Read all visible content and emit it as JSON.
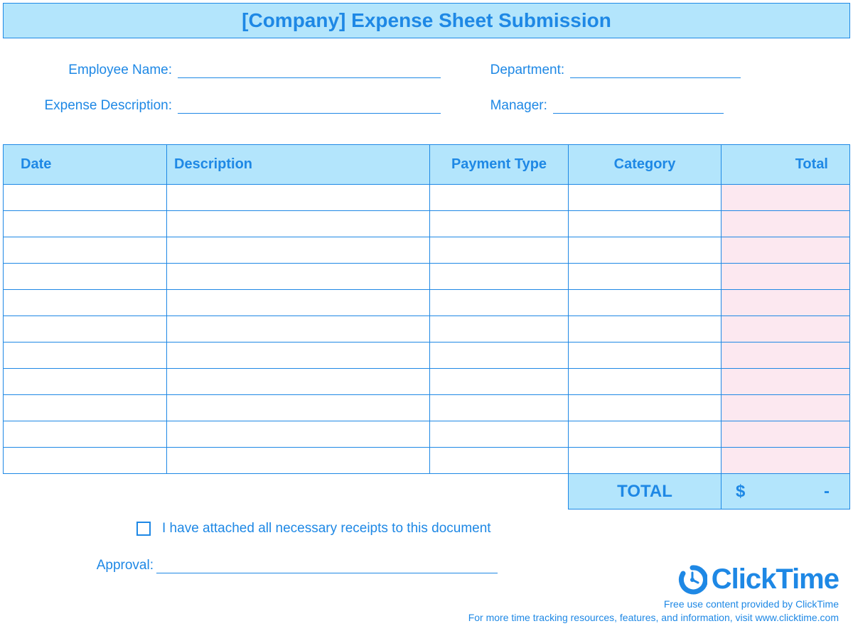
{
  "title": "[Company] Expense Sheet Submission",
  "info": {
    "employee_name_label": "Employee Name:",
    "department_label": "Department:",
    "expense_description_label": "Expense Description:",
    "manager_label": "Manager:"
  },
  "table": {
    "headers": {
      "date": "Date",
      "description": "Description",
      "payment_type": "Payment Type",
      "category": "Category",
      "total": "Total"
    },
    "total_label": "TOTAL",
    "total_currency": "$",
    "total_value": "-"
  },
  "checkbox_label": "I have attached all necessary receipts to this document",
  "approval_label": "Approval:",
  "logo": {
    "text": "ClickTime"
  },
  "footer": {
    "line1": "Free use content provided by ClickTime",
    "line2": "For more time tracking resources, features, and information, visit www.clicktime.com"
  }
}
